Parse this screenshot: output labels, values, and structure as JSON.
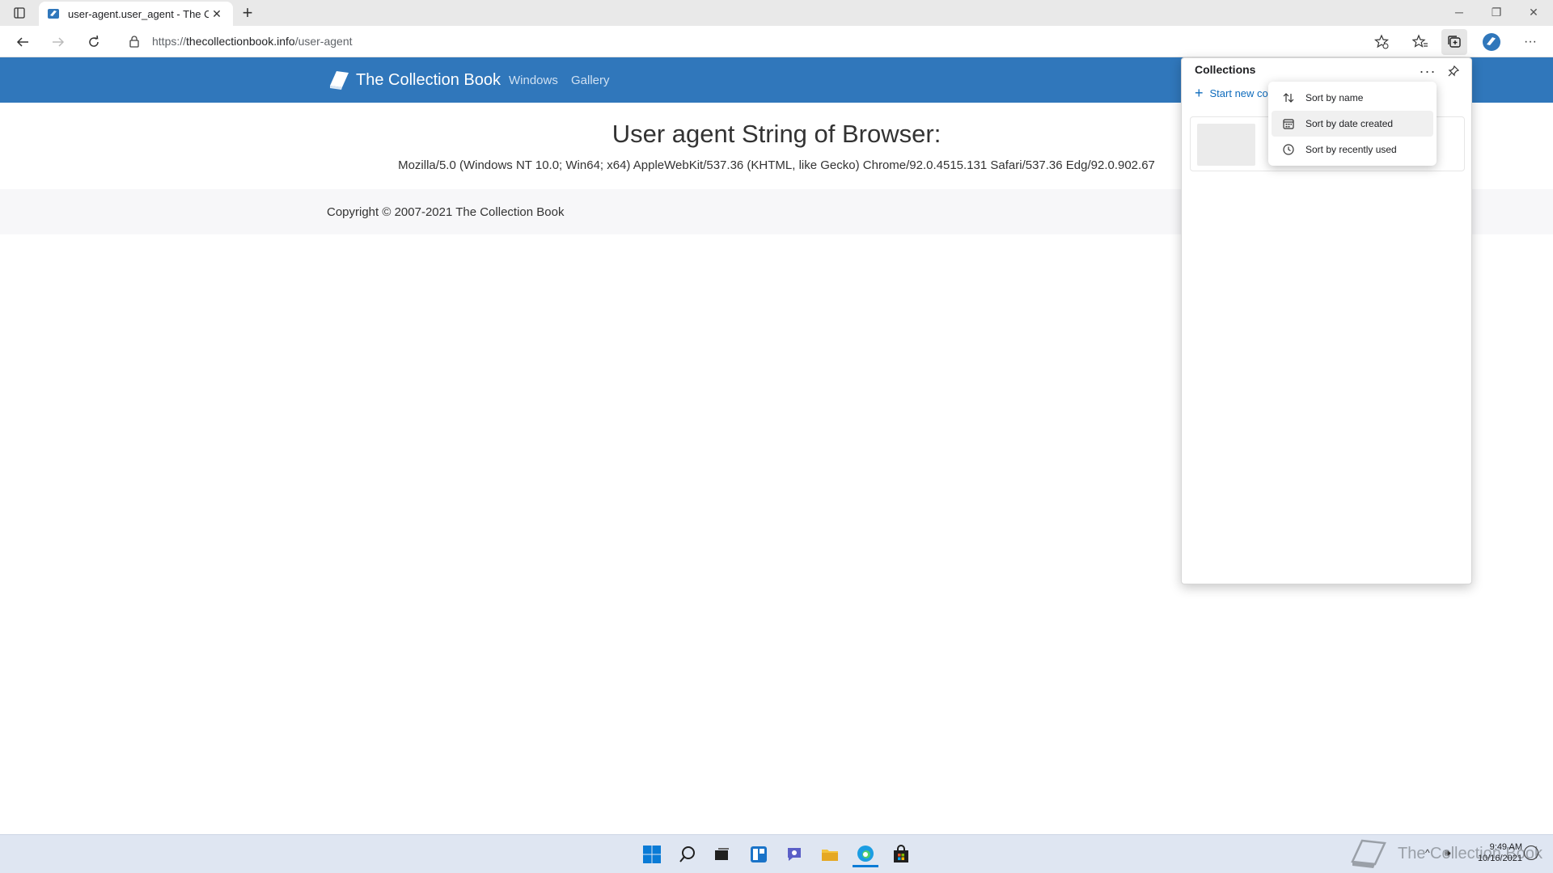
{
  "browser": {
    "tab": {
      "title": "user-agent.user_agent - The Coll"
    },
    "new_tab": "+",
    "window_controls": {
      "minimize": "─",
      "restore": "❐",
      "close": "✕"
    },
    "toolbar": {
      "url_scheme": "https://",
      "url_host": "thecollectionbook.info",
      "url_path": "/user-agent"
    }
  },
  "site": {
    "brand": "The Collection Book",
    "nav": [
      "Windows",
      "Gallery"
    ],
    "heading": "User agent String of Browser:",
    "user_agent": "Mozilla/5.0 (Windows NT 10.0; Win64; x64) AppleWebKit/537.36 (KHTML, like Gecko) Chrome/92.0.4515.131 Safari/537.36 Edg/92.0.902.67",
    "footer": "Copyright © 2007-2021 The Collection Book"
  },
  "collections": {
    "title": "Collections",
    "start_new": "Start new co",
    "more": "···",
    "sort_menu": [
      {
        "label": "Sort by name",
        "icon": "sort-arrows-icon"
      },
      {
        "label": "Sort by date created",
        "icon": "calendar-icon",
        "hovered": true
      },
      {
        "label": "Sort by recently used",
        "icon": "clock-icon"
      }
    ]
  },
  "taskbar": {
    "watermark": "The Collection Book",
    "time": "9:49 AM",
    "date": "10/16/2021"
  },
  "colors": {
    "site_header": "#3077bb",
    "accent": "#0f6cbd"
  }
}
